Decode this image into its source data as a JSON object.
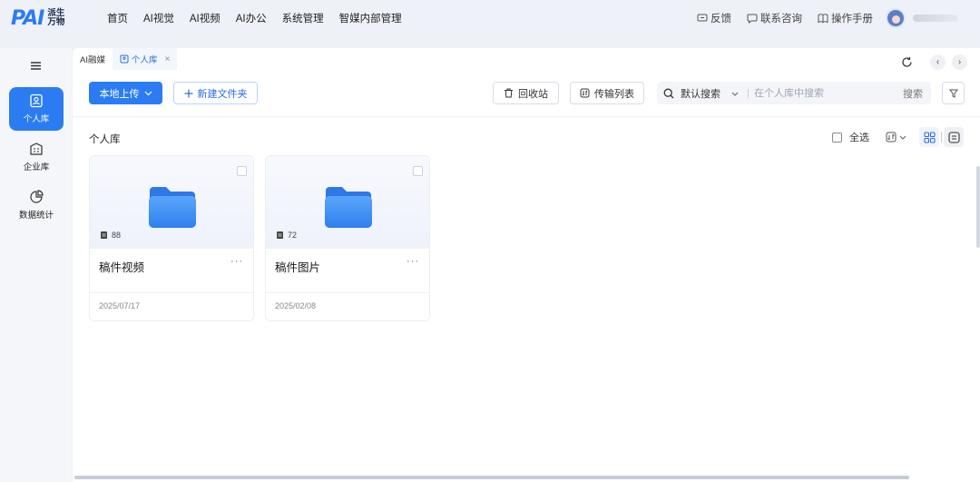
{
  "logo": {
    "mark": "PAI",
    "text_line1": "派生",
    "text_line2": "万物"
  },
  "nav": [
    {
      "label": "首页"
    },
    {
      "label": "AI视觉"
    },
    {
      "label": "AI视频"
    },
    {
      "label": "AI办公"
    },
    {
      "label": "系统管理"
    },
    {
      "label": "智媒内部管理"
    }
  ],
  "top_links": {
    "feedback": "反馈",
    "contact": "联系咨询",
    "manual": "操作手册"
  },
  "sidebar": {
    "items": [
      {
        "label": "个人库",
        "icon": "personal-library-icon"
      },
      {
        "label": "企业库",
        "icon": "enterprise-library-icon"
      },
      {
        "label": "数据统计",
        "icon": "statistics-icon"
      }
    ]
  },
  "tabs": {
    "parent": "AI融媒",
    "active": "个人库",
    "close": "×"
  },
  "toolbar": {
    "upload": "本地上传",
    "new_folder": "新建文件夹",
    "recycle": "回收站",
    "transfer": "传输列表",
    "search_mode": "默认搜索",
    "search_placeholder": "在个人库中搜索",
    "search_go": "搜索"
  },
  "content": {
    "title": "个人库",
    "select_all": "全选"
  },
  "folders": [
    {
      "name": "稿件视频",
      "count": "88",
      "date": "2025/07/17"
    },
    {
      "name": "稿件图片",
      "count": "72",
      "date": "2025/02/08"
    }
  ],
  "colors": {
    "accent": "#2b7cf2",
    "folder": "#3b8ff6"
  }
}
